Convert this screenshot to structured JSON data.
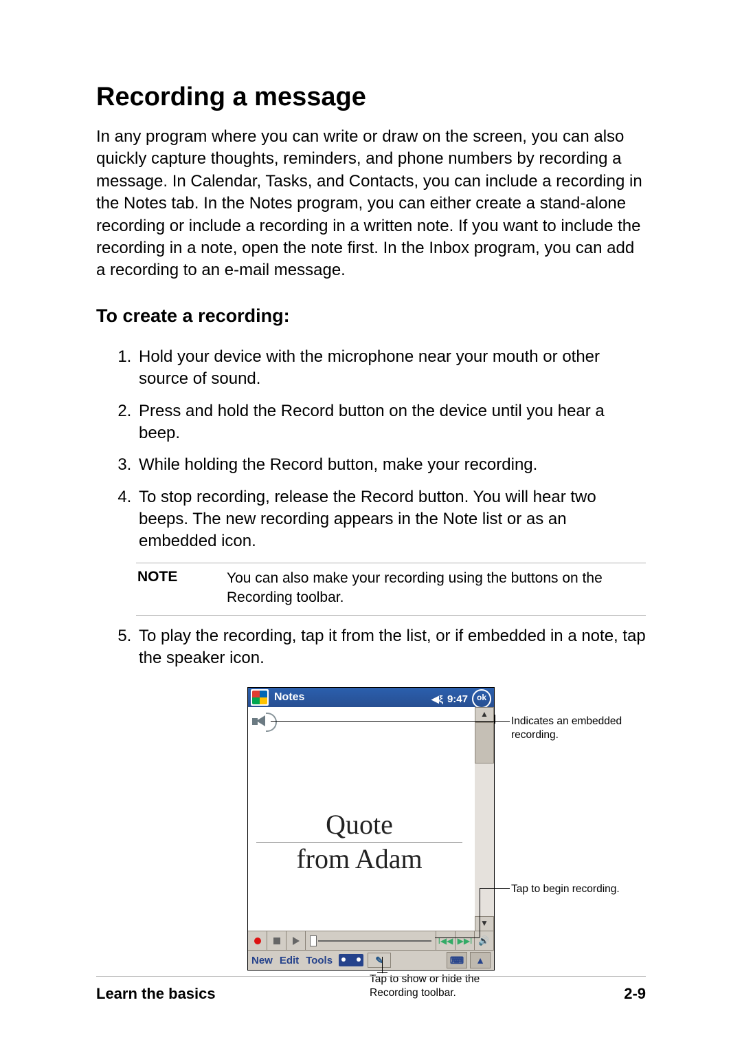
{
  "title": "Recording a message",
  "intro": "In any program where you can write or draw on the screen, you can also quickly capture thoughts, reminders, and phone numbers by recording a message. In Calendar, Tasks, and Contacts,  you can include a recording in the Notes tab. In the Notes program, you can either create a stand-alone recording or include a recording in a written note. If you want to include the recording in a note, open the note first. In the Inbox program, you can add a recording to an e-mail message.",
  "subhead": "To create a recording:",
  "steps": {
    "s1": "Hold your device with the microphone near your mouth or other source of sound.",
    "s2": "Press and hold the Record button on the device until you hear a beep.",
    "s3": "While holding the Record button, make your recording.",
    "s4": "To stop recording, release the Record button. You will hear two beeps. The new recording appears in the Note list or as an embedded icon.",
    "s5": "To play the recording, tap it from the list, or if embedded in a note, tap the speaker icon."
  },
  "note_label": "NOTE",
  "note_text": "You can also make your recording using the buttons on the Recording toolbar.",
  "screenshot": {
    "app_name": "Notes",
    "time": "9:47",
    "ok": "ok",
    "hand_line1": "Quote",
    "hand_line2": "from Adam",
    "menu_new": "New",
    "menu_edit": "Edit",
    "menu_tools": "Tools"
  },
  "callouts": {
    "embedded": "Indicates an embedded recording.",
    "begin": "Tap to begin recording.",
    "toolbar": "Tap to show or hide the Recording toolbar."
  },
  "footer": {
    "left": "Learn the basics",
    "right": "2-9"
  }
}
